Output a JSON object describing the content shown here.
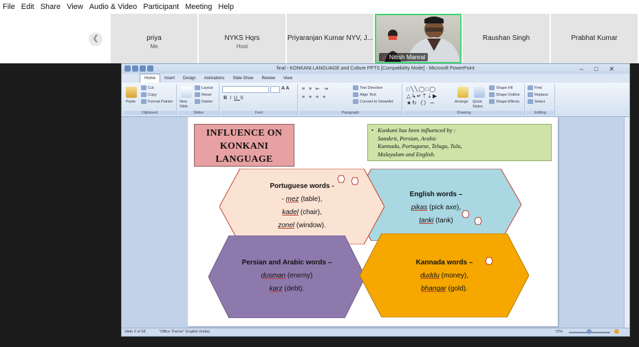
{
  "zoom_menu": [
    "File",
    "Edit",
    "Share",
    "View",
    "Audio & Video",
    "Participant",
    "Meeting",
    "Help"
  ],
  "participants": [
    {
      "name": "priya",
      "sub": "Me"
    },
    {
      "name": "NYKS Hqrs",
      "sub": "Host"
    },
    {
      "name": "Priyaranjan Kumar NYV, J...",
      "sub": ""
    },
    {
      "name": "Nitish Manral",
      "sub": ""
    },
    {
      "name": "Raushan Singh",
      "sub": ""
    },
    {
      "name": "Prabhat Kumar",
      "sub": ""
    }
  ],
  "ppt": {
    "title": "final - KONKANI LANGUAGE and Culture PPTS [Compatibility Mode] - Microsoft PowerPoint",
    "tabs": [
      "Home",
      "Insert",
      "Design",
      "Animations",
      "Slide Show",
      "Review",
      "View"
    ],
    "ribbon": {
      "clipboard": {
        "paste": "Paste",
        "cut": "Cut",
        "copy": "Copy",
        "format_painter": "Format Painter",
        "label": "Clipboard"
      },
      "slides": {
        "new_slide": "New Slide",
        "layout": "Layout",
        "reset": "Reset",
        "delete": "Delete",
        "label": "Slides"
      },
      "font": {
        "label": "Font"
      },
      "paragraph": {
        "text_direction": "Text Direction",
        "align_text": "Align Text",
        "convert": "Convert to SmartArt",
        "label": "Paragraph"
      },
      "drawing": {
        "arrange": "Arrange",
        "quick_styles": "Quick Styles",
        "shape_fill": "Shape Fill",
        "shape_outline": "Shape Outline",
        "shape_effects": "Shape Effects",
        "label": "Drawing"
      },
      "editing": {
        "find": "Find",
        "replace": "Replace",
        "select": "Select",
        "label": "Editing"
      }
    },
    "status": {
      "slide": "Slide 2 of 58",
      "theme": "\"Office Theme\"",
      "language": "English (India)",
      "zoom": "72%"
    }
  },
  "slide": {
    "title": "INFLUENCE ON KONKANI LANGUAGE",
    "note": {
      "bullet": "Konkani has been influenced by :",
      "lines": [
        "Sanskrit, Persian, Arabic",
        "Kannada, Portuguese, Telugu, Tulu,",
        "Malayalam and English."
      ]
    },
    "portuguese": {
      "heading": "Portuguese words -",
      "w1": "mez",
      "g1": " (table),",
      "w2": "kadel",
      "g2": " (chair),",
      "w3": "zonel",
      "g3": " (window)."
    },
    "english": {
      "heading": "English words –",
      "w1": "pikas",
      "g1": " (pick axe),",
      "w2": "tanki",
      "g2": " (tank)"
    },
    "persian": {
      "heading": "Persian and Arabic words –",
      "w1": "dusman",
      "g1": " (enemy)",
      "w2": "karz",
      "g2": " (debt)."
    },
    "kannada": {
      "heading": "Kannada words –",
      "w1": "duddu",
      "g1": " (money),",
      "w2": "bhangar",
      "g2": " (gold)."
    }
  },
  "colors": {
    "video_border": "#3fd86b",
    "title_fill": "#e8a1a2",
    "note_fill": "#cfe3a8",
    "portuguese_fill": "#fbe3d4",
    "english_fill": "#a9d8e2",
    "persian_fill": "#8e79ad",
    "kannada_fill": "#f6a800"
  }
}
